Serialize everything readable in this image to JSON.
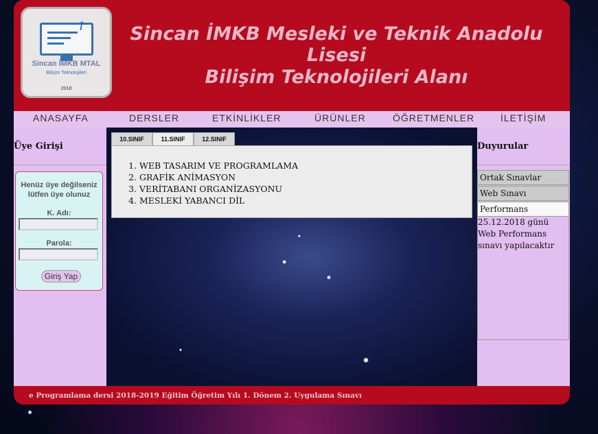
{
  "header": {
    "logo": {
      "name": "Sincan İMKB MTAL",
      "subtitle": "Bilişim Teknolojileri",
      "year": "2018"
    },
    "title_line1": "Sincan İMKB Mesleki ve Teknik Anadolu Lisesi",
    "title_line2": "Bilişim Teknolojileri Alanı"
  },
  "nav": {
    "items": [
      "ANASAYFA",
      "DERSLER",
      "ETKİNLİKLER",
      "ÜRÜNLER",
      "ÖĞRETMENLER",
      "İLETİŞİM"
    ]
  },
  "left": {
    "title": "Üye Girişi",
    "login": {
      "message": "Henüz üye değilseniz lütfen üye olunuz",
      "username_label": "K. Adı:",
      "username_value": "",
      "password_label": "Parola:",
      "password_value": "",
      "submit_label": "Giriş Yap"
    }
  },
  "center": {
    "tabs": [
      {
        "label": "10.SINIF",
        "active": false
      },
      {
        "label": "11.SINIF",
        "active": true
      },
      {
        "label": "12.SINIF",
        "active": false
      }
    ],
    "courses": [
      "WEB TASARIM VE PROGRAMLAMA",
      "GRAFİK ANİMASYON",
      "VERİTABANI ORGANİZASYONU",
      "MESLEKİ YABANCI DİL"
    ]
  },
  "right": {
    "title": "Duyurular",
    "sections": [
      "Ortak Sınavlar",
      "Web Sınavı",
      "Performans"
    ],
    "expanded_text": "25.12.2018 günü Web Performans sınavı yapılacaktır"
  },
  "footer": {
    "marquee": "e Programlama dersi 2018-2019 Eğitim Öğretim Yılı 1. Dönem 2. Uygulama Sınavı"
  },
  "colors": {
    "header_red": "#b60a1e",
    "side_lilac": "#e2bff0",
    "title_pink": "#e6b8c8"
  }
}
